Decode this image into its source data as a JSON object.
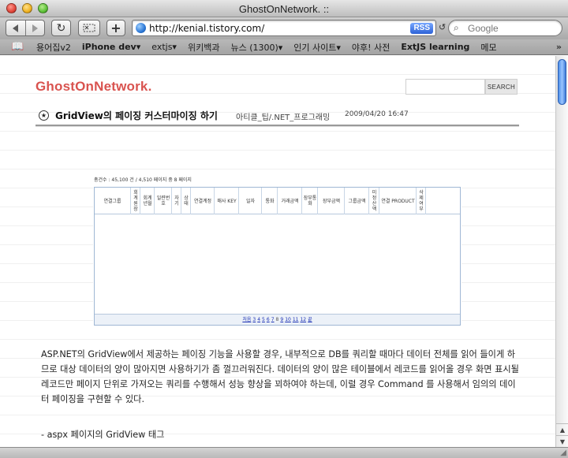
{
  "window": {
    "title": "GhostOnNetwork. ::"
  },
  "toolbar": {
    "url": "http://kenial.tistory.com/",
    "rss_label": "RSS",
    "search_placeholder": "Google"
  },
  "bookmarks": [
    {
      "label": "용어집v2",
      "bold": false
    },
    {
      "label": "iPhone dev▾",
      "bold": true
    },
    {
      "label": "extjs▾",
      "bold": false
    },
    {
      "label": "위키백과",
      "bold": false
    },
    {
      "label": "뉴스 (1300)▾",
      "bold": false
    },
    {
      "label": "인기 사이트▾",
      "bold": false
    },
    {
      "label": "야후! 사전",
      "bold": false
    },
    {
      "label": "ExtJS learning",
      "bold": true
    },
    {
      "label": "메모",
      "bold": false
    }
  ],
  "page": {
    "blog_title": "GhostOnNetwork.",
    "search_button": "SEARCH",
    "post": {
      "title": "GridView의 페이징 커스터마이징 하기",
      "category": "아티클_팁/.NET_프로그래밍",
      "date": "2009/04/20 16:47"
    },
    "grid": {
      "summary": "총건수 : 45,100 건 / 4,510 페이지 중 8 페이지",
      "columns": [
        "연결그룹",
        "회계원장",
        "회계년월",
        "일련번호",
        "자기",
        "상태",
        "연결계정",
        "매사 KEY",
        "일자",
        "통화",
        "거래금액",
        "장부통화",
        "장부금액",
        "그룹금액",
        "미정산액",
        "연결 PRODUCT",
        "삭제여부"
      ],
      "pager": {
        "first": "처음",
        "pages": [
          "3",
          "4",
          "5",
          "6",
          "7",
          "8",
          "9",
          "10",
          "11",
          "12"
        ],
        "current": "8",
        "last": "끝"
      }
    },
    "article": {
      "paragraph": "ASP.NET의 GridView에서 제공하는 페이징 기능을 사용할 경우, 내부적으로 DB를 쿼리할 때마다 데이터 전체를 읽어 들이게 하므로 대상 데이터의 양이 많아지면 사용하기가 좀 껄끄러워진다. 데이터의 양이 많은 테이블에서 레코드를 읽어올 경우 화면 표시될 레코드만 페이지 단위로 가져오는 쿼리를 수행해서 성능 향상을 꾀하여야 하는데, 이럴 경우 Command 를 사용해서 임의의 데이터 페이징을 구현할 수 있다.",
      "subheading": "- aspx 페이지의 GridView 태그"
    }
  },
  "colors": {
    "blog_title": "#d9534f",
    "link": "#1a2fb3",
    "scroll_thumb": "#4d8ee8"
  }
}
